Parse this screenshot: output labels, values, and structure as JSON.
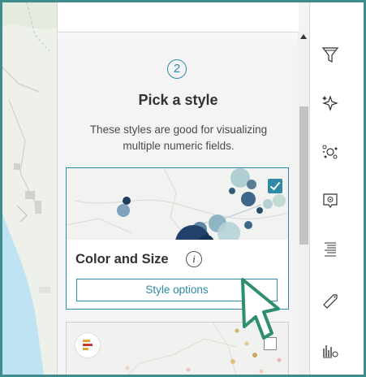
{
  "panel": {
    "step_number": "2",
    "title": "Pick a style",
    "description": "These styles are good for visualizing multiple numeric fields."
  },
  "style_cards": [
    {
      "title": "Color and Size",
      "selected": true,
      "options_button_label": "Style options"
    },
    {
      "title": "",
      "selected": false
    }
  ],
  "toolbar": {
    "tools": [
      {
        "icon": "filter-icon"
      },
      {
        "icon": "effects-icon"
      },
      {
        "icon": "clustering-icon"
      },
      {
        "icon": "popup-icon"
      },
      {
        "icon": "fields-icon"
      },
      {
        "icon": "labels-icon"
      },
      {
        "icon": "charts-icon"
      }
    ]
  },
  "colors": {
    "accent": "#2e8aa5",
    "frame": "#3f8c8c"
  }
}
